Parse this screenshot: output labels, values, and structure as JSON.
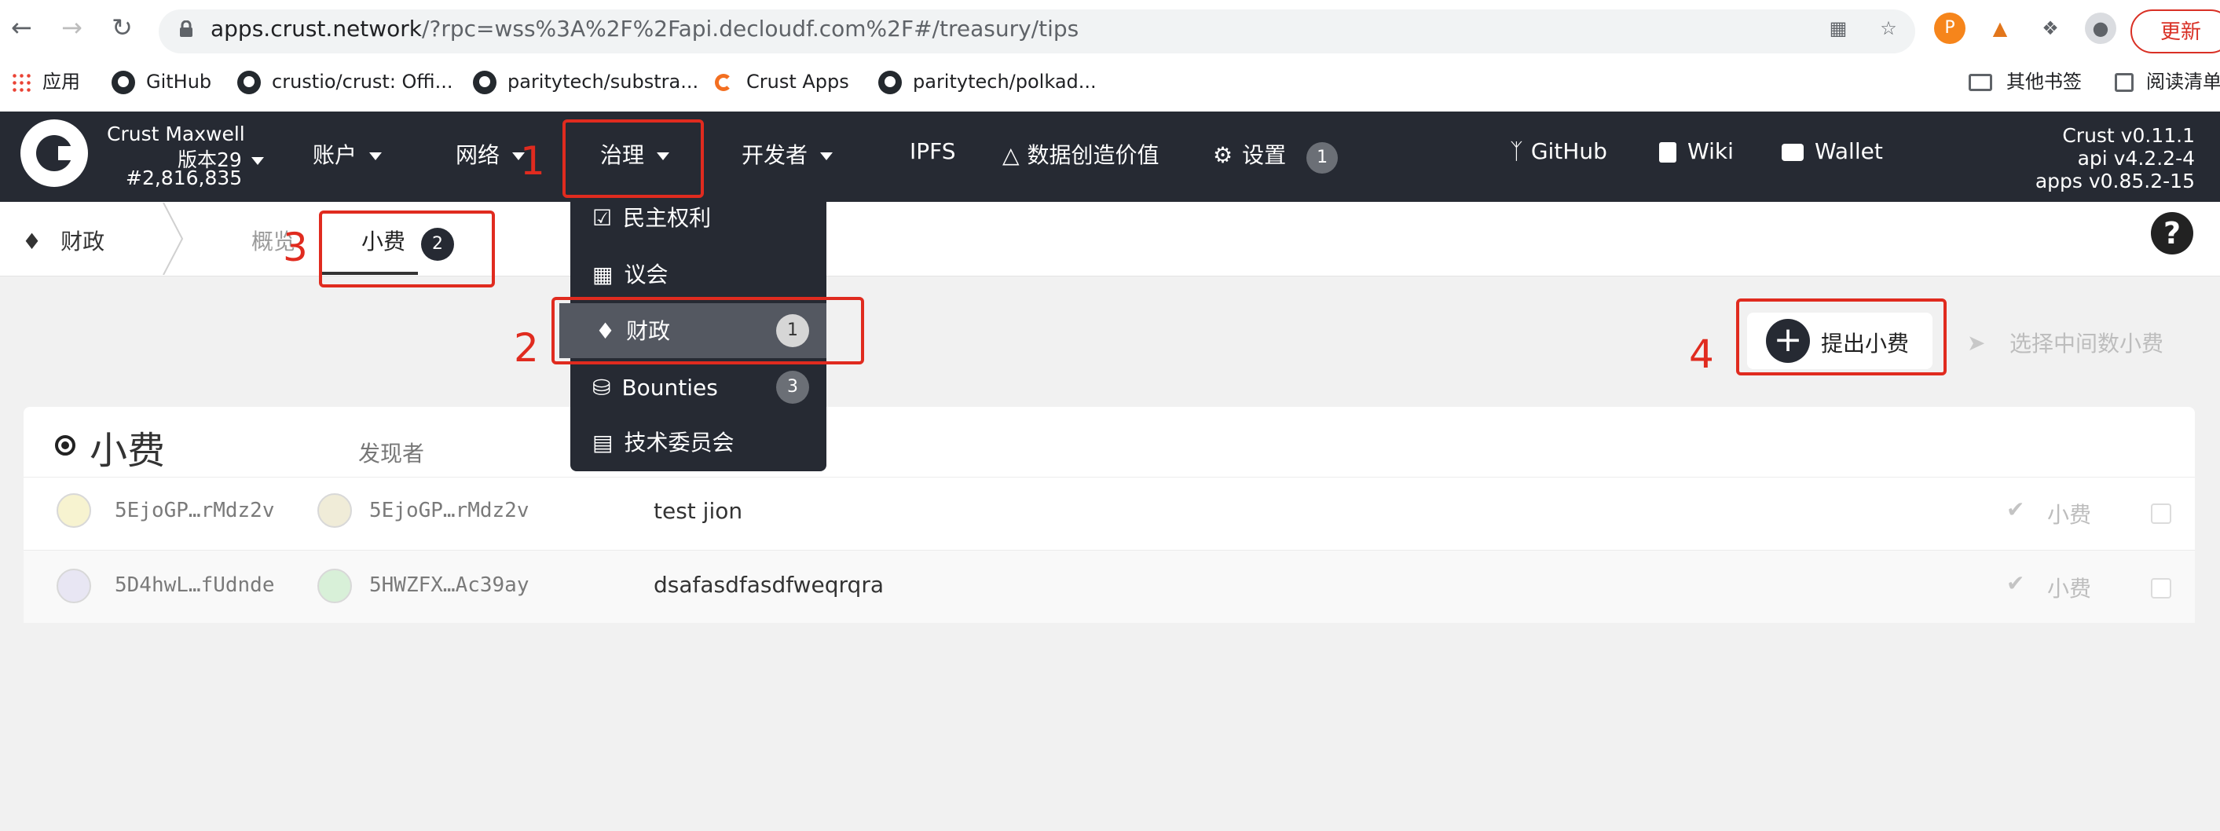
{
  "browser": {
    "url_host": "apps.crust.network",
    "url_path": "/?rpc=wss%3A%2F%2Fapi.decloudf.com%2F#/treasury/tips",
    "update_label": "更新",
    "bookmarks": [
      "应用",
      "GitHub",
      "crustio/crust: Offi...",
      "paritytech/substra...",
      "Crust Apps",
      "paritytech/polkad..."
    ],
    "other_bookmarks": "其他书签",
    "reading_list": "阅读清单"
  },
  "header": {
    "chain_name": "Crust Maxwell",
    "version": "版本29",
    "block": "#2,816,835",
    "menu": {
      "accounts": "账户",
      "network": "网络",
      "governance": "治理",
      "developer": "开发者",
      "ipfs": "IPFS",
      "data_value": "数据创造价值",
      "settings": "设置",
      "settings_badge": "1",
      "github": "GitHub",
      "wiki": "Wiki",
      "wallet": "Wallet"
    },
    "versions": {
      "crust": "Crust v0.11.1",
      "api": "api v4.2.2-4",
      "apps": "apps v0.85.2-15"
    }
  },
  "dropdown": {
    "items": [
      {
        "label": "民主权利",
        "badge": ""
      },
      {
        "label": "议会",
        "badge": ""
      },
      {
        "label": "财政",
        "badge": "1"
      },
      {
        "label": "Bounties",
        "badge": "3"
      },
      {
        "label": "技术委员会",
        "badge": ""
      }
    ]
  },
  "subnav": {
    "section": "财政",
    "overview": "概览",
    "tips": "小费",
    "tips_badge": "2"
  },
  "actions": {
    "propose_tip": "提出小费",
    "close_median": "选择中间数小费"
  },
  "table": {
    "title": "小费",
    "col_finder": "发现者",
    "rows": [
      {
        "who": "5EjoGP…rMdz2v",
        "finder": "5EjoGP…rMdz2v",
        "reason": "test jion",
        "tip_label": "小费"
      },
      {
        "who": "5D4hwL…fUdnde",
        "finder": "5HWZFX…Ac39ay",
        "reason": "dsafasdfasdfweqrqra",
        "tip_label": "小费"
      }
    ]
  },
  "annotations": [
    "1",
    "2",
    "3",
    "4"
  ],
  "colors": {
    "header_bg": "#262a33",
    "annotation_red": "#e02b1f",
    "page_bg": "#f1f1f1"
  }
}
